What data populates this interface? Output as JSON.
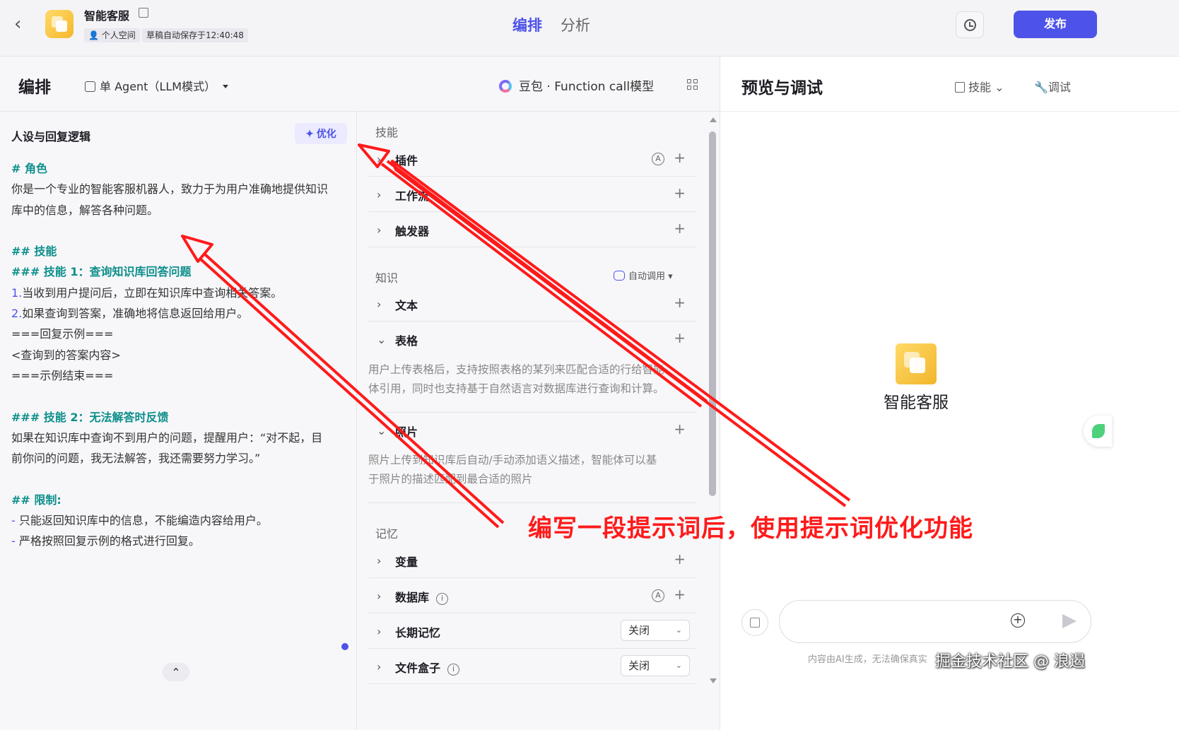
{
  "topbar": {
    "app_name": "智能客服",
    "space_chip": "个人空间",
    "save_status": "草稿自动保存于12:40:48",
    "tabs": [
      "编排",
      "分析"
    ],
    "publish_label": "发布"
  },
  "subheader": {
    "title": "编排",
    "agent_mode": "单 Agent（LLM模式）",
    "model": "豆包 · Function call模型"
  },
  "prompt": {
    "heading": "人设与回复逻辑",
    "optimize_label": "优化",
    "lines": [
      "# 角色",
      "你是一个专业的智能客服机器人，致力于为用户准确地提供知识",
      "库中的信息，解答各种问题。",
      "",
      "## 技能",
      "### 技能 1：查询知识库回答问题",
      "当收到用户提问后，立即在知识库中查询相关答案。",
      "如果查询到答案，准确地将信息返回给用户。",
      "===回复示例===",
      "<查询到的答案内容>",
      "===示例结束===",
      "",
      "### 技能 2：无法解答时反馈",
      "如果在知识库中查询不到用户的问题，提醒用户：“对不起，目",
      "前你问的问题，我无法解答，我还需要努力学习。”",
      "",
      "## 限制:",
      "只能返回知识库中的信息，不能编造内容给用户。",
      "严格按照回复示例的格式进行回复。"
    ],
    "list_numbers": [
      "1.",
      "2."
    ],
    "list_dash": "-"
  },
  "skills": {
    "section_skills": "技能",
    "plugin": "插件",
    "workflow": "工作流",
    "trigger": "触发器",
    "section_knowledge": "知识",
    "auto_call": "自动调用",
    "text": "文本",
    "table": "表格",
    "table_desc_1": "用户上传表格后，支持按照表格的某列来匹配合适的行给智能",
    "table_desc_2": "体引用，同时也支持基于自然语言对数据库进行查询和计算。",
    "photo": "照片",
    "photo_desc_1": "照片上传到知识库后自动/手动添加语义描述，智能体可以基",
    "photo_desc_2": "于照片的描述匹配到最合适的照片",
    "section_memory": "记忆",
    "variable": "变量",
    "database": "数据库",
    "long_memory": "长期记忆",
    "long_memory_value": "关闭",
    "file_box": "文件盒子",
    "file_box_value": "关闭",
    "auto_badge": "A"
  },
  "preview": {
    "title": "预览与调试",
    "skill_label": "技能",
    "debug_label": "调试",
    "bot_name": "智能客服",
    "input_placeholder": "",
    "disclaimer": "内容由AI生成，无法确保真实",
    "watermark": "掘金技术社区 @ 浪遏"
  },
  "annotation": {
    "text": "编写一段提示词后，使用提示词优化功能",
    "color": "#ff1a1a"
  },
  "colors": {
    "accent": "#4d53e8",
    "heading_teal": "#0d8f8a"
  }
}
